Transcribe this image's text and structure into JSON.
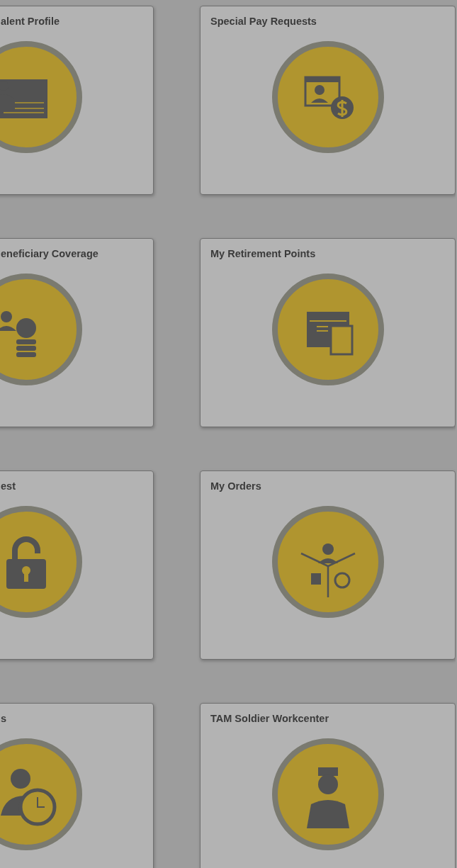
{
  "tiles": [
    {
      "title": "alent Profile"
    },
    {
      "title": "Special Pay Requests"
    },
    {
      "title": "eneficiary Coverage"
    },
    {
      "title": "My Retirement Points"
    },
    {
      "title": "est"
    },
    {
      "title": "My Orders"
    },
    {
      "title": "s"
    },
    {
      "title": "TAM Soldier Workcenter"
    }
  ]
}
